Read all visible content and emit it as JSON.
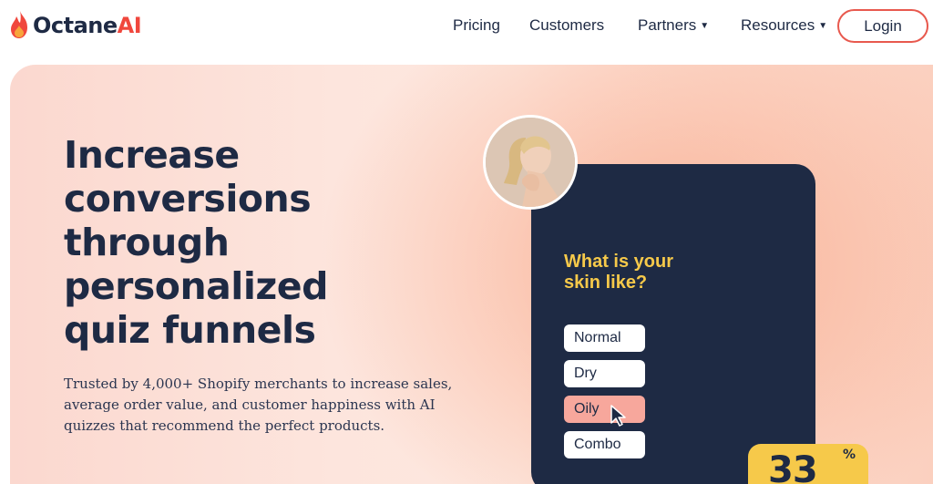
{
  "brand": {
    "name_prefix": "Octane",
    "name_suffix": "AI",
    "accent_color": "#f0473d",
    "logo_icon": "flame-icon"
  },
  "nav": {
    "items": [
      {
        "label": "Pricing",
        "has_dropdown": false
      },
      {
        "label": "Customers",
        "has_dropdown": false
      },
      {
        "label": "Partners",
        "has_dropdown": true
      },
      {
        "label": "Resources",
        "has_dropdown": true
      }
    ],
    "dropdown_caret": "▼",
    "login_label": "Login"
  },
  "hero": {
    "headline_lines": [
      "Increase",
      "conversions",
      "through",
      "personalized",
      "quiz funnels"
    ],
    "subtext_lines": [
      "Trusted by 4,000+ Shopify merchants to increase sales,",
      "average order value, and customer happiness with AI",
      "quizzes that recommend the perfect products."
    ]
  },
  "quiz": {
    "question_lines": [
      "What is your",
      "skin like?"
    ],
    "options": [
      "Normal",
      "Dry",
      "Oily",
      "Combo"
    ],
    "selected": "Oily",
    "question_color": "#f6c94a",
    "selected_color": "#f7a79c",
    "card_color": "#1e2a44"
  },
  "stat_badge": {
    "value": "33",
    "unit": "%"
  },
  "colors": {
    "text_dark": "#1e2a44",
    "login_border": "#e8594e"
  }
}
